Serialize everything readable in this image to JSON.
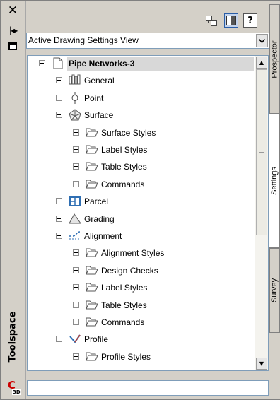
{
  "palette": {
    "accent": "#2a5ea8",
    "selection_band": "#d8d8d8",
    "logo_red": "#cc0000"
  },
  "window": {
    "title": "Toolspace",
    "logo": "C3D"
  },
  "left_strip": {
    "close_icon": "x-close-icon",
    "autohide_icon": "autohide-icon",
    "properties_icon": "properties-icon",
    "close_glyph": "✕",
    "autohide_glyph": "|◂▸"
  },
  "toolbar": {
    "buttons": [
      "hierarchy-view-icon",
      "item-view-icon",
      "help-icon"
    ],
    "help_glyph": "?"
  },
  "view_select": {
    "value": "Active Drawing Settings View",
    "arrow": "chevron-down-icon"
  },
  "tree": [
    {
      "label": "Pipe Networks-3",
      "level": 0,
      "state": "expanded",
      "icon": "drawing-icon",
      "selected": true
    },
    {
      "label": "General",
      "level": 1,
      "state": "collapsed",
      "icon": "general-icon"
    },
    {
      "label": "Point",
      "level": 1,
      "state": "collapsed",
      "icon": "point-icon"
    },
    {
      "label": "Surface",
      "level": 1,
      "state": "expanded",
      "icon": "surface-icon"
    },
    {
      "label": "Surface Styles",
      "level": 2,
      "state": "collapsed",
      "icon": "folder-icon"
    },
    {
      "label": "Label Styles",
      "level": 2,
      "state": "collapsed",
      "icon": "folder-icon"
    },
    {
      "label": "Table Styles",
      "level": 2,
      "state": "collapsed",
      "icon": "folder-icon"
    },
    {
      "label": "Commands",
      "level": 2,
      "state": "collapsed",
      "icon": "folder-icon"
    },
    {
      "label": "Parcel",
      "level": 1,
      "state": "collapsed",
      "icon": "parcel-icon"
    },
    {
      "label": "Grading",
      "level": 1,
      "state": "collapsed",
      "icon": "grading-icon"
    },
    {
      "label": "Alignment",
      "level": 1,
      "state": "expanded",
      "icon": "alignment-icon"
    },
    {
      "label": "Alignment Styles",
      "level": 2,
      "state": "collapsed",
      "icon": "folder-icon"
    },
    {
      "label": "Design Checks",
      "level": 2,
      "state": "collapsed",
      "icon": "folder-icon"
    },
    {
      "label": "Label Styles",
      "level": 2,
      "state": "collapsed",
      "icon": "folder-icon"
    },
    {
      "label": "Table Styles",
      "level": 2,
      "state": "collapsed",
      "icon": "folder-icon"
    },
    {
      "label": "Commands",
      "level": 2,
      "state": "collapsed",
      "icon": "folder-icon"
    },
    {
      "label": "Profile",
      "level": 1,
      "state": "expanded",
      "icon": "profile-icon"
    },
    {
      "label": "Profile Styles",
      "level": 2,
      "state": "collapsed",
      "icon": "folder-icon"
    }
  ],
  "scrollbar": {
    "up_icon": "scroll-up-icon",
    "down_icon": "scroll-down-icon",
    "up_glyph": "▲",
    "down_glyph": "▼"
  },
  "tabs": [
    {
      "label": "Prospector",
      "active": false
    },
    {
      "label": "Settings",
      "active": true
    },
    {
      "label": "Survey",
      "active": false
    }
  ]
}
